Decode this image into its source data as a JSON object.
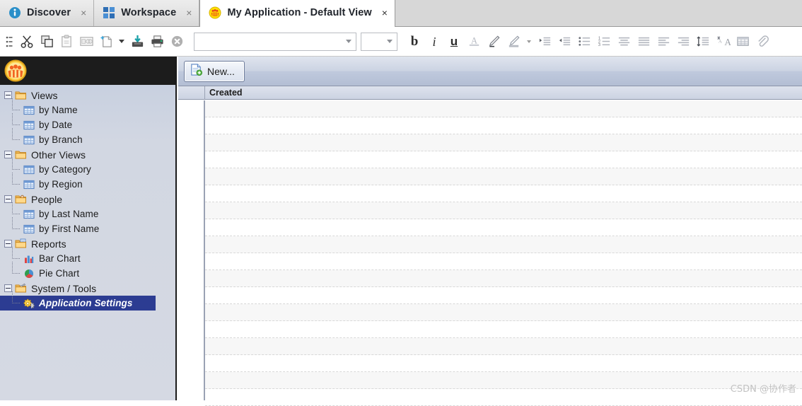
{
  "window": {
    "tabs": [
      {
        "label": "Discover",
        "icon": "info-icon",
        "close": "×",
        "active": false
      },
      {
        "label": "Workspace",
        "icon": "grid-squares-icon",
        "close": "×",
        "active": false
      },
      {
        "label": "My Application - Default View",
        "icon": "app-logo-icon",
        "close": "×",
        "active": true
      }
    ]
  },
  "toolbar": {
    "items": [
      {
        "name": "menu-handle-icon",
        "glyph": ""
      },
      {
        "name": "cut-icon",
        "glyph": ""
      },
      {
        "name": "copy-icon",
        "glyph": ""
      },
      {
        "name": "paste-icon",
        "glyph": ""
      },
      {
        "name": "paste-special-icon",
        "glyph": ""
      },
      {
        "name": "new-document-icon",
        "glyph": ""
      },
      {
        "name": "new-document-dropdown-icon",
        "glyph": ""
      },
      {
        "name": "save-icon",
        "glyph": ""
      },
      {
        "name": "print-icon",
        "glyph": ""
      },
      {
        "name": "delete-icon",
        "glyph": ""
      }
    ],
    "font_family_combo": {
      "value": "",
      "placeholder": ""
    },
    "font_size_combo": {
      "value": "",
      "placeholder": ""
    },
    "bold_label": "b",
    "italic_label": "i",
    "underline_label": "u",
    "format_items": [
      {
        "name": "font-color-icon"
      },
      {
        "name": "highlight-pen-icon"
      },
      {
        "name": "highlight-color-icon"
      },
      {
        "name": "highlight-color-dropdown-icon"
      },
      {
        "name": "increase-indent-icon"
      },
      {
        "name": "decrease-indent-icon"
      },
      {
        "name": "bullet-list-icon"
      },
      {
        "name": "numbered-list-icon"
      },
      {
        "name": "align-center-icon"
      },
      {
        "name": "align-justify-icon"
      },
      {
        "name": "align-left-icon"
      },
      {
        "name": "align-right-icon"
      },
      {
        "name": "line-spacing-icon"
      },
      {
        "name": "clear-formatting-icon"
      },
      {
        "name": "insert-table-icon"
      },
      {
        "name": "attachment-icon"
      }
    ]
  },
  "sidebar": {
    "brand": {
      "name": "app-logo-icon",
      "title": ""
    },
    "tree": [
      {
        "label": "Views",
        "type": "group",
        "icon": "folder-icon",
        "expanded": true,
        "selected": false
      },
      {
        "label": "by Name",
        "type": "child",
        "icon": "table-view-icon",
        "expanded": false,
        "selected": false
      },
      {
        "label": "by Date",
        "type": "child",
        "icon": "table-view-icon",
        "expanded": false,
        "selected": false
      },
      {
        "label": "by Branch",
        "type": "child",
        "icon": "table-view-icon",
        "expanded": false,
        "selected": false,
        "last": true
      },
      {
        "label": "Other Views",
        "type": "group",
        "icon": "folder-icon",
        "expanded": true,
        "selected": false
      },
      {
        "label": "by Category",
        "type": "child",
        "icon": "table-view-icon",
        "expanded": false,
        "selected": false
      },
      {
        "label": "by Region",
        "type": "child",
        "icon": "table-view-icon",
        "expanded": false,
        "selected": false,
        "last": true
      },
      {
        "label": "People",
        "type": "group",
        "icon": "people-folder-icon",
        "expanded": true,
        "selected": false
      },
      {
        "label": "by Last Name",
        "type": "child",
        "icon": "table-view-icon",
        "expanded": false,
        "selected": false
      },
      {
        "label": "by First Name",
        "type": "child",
        "icon": "table-view-icon",
        "expanded": false,
        "selected": false,
        "last": true
      },
      {
        "label": "Reports",
        "type": "group",
        "icon": "reports-folder-icon",
        "expanded": true,
        "selected": false
      },
      {
        "label": "Bar Chart",
        "type": "child",
        "icon": "bar-chart-icon",
        "expanded": false,
        "selected": false
      },
      {
        "label": "Pie Chart",
        "type": "child",
        "icon": "pie-chart-icon",
        "expanded": false,
        "selected": false,
        "last": true
      },
      {
        "label": "System / Tools",
        "type": "group",
        "icon": "tools-folder-icon",
        "expanded": true,
        "selected": false
      },
      {
        "label": "Application Settings",
        "type": "child",
        "icon": "settings-gears-icon",
        "expanded": false,
        "selected": true,
        "last": true
      }
    ]
  },
  "main": {
    "new_button_label": "New...",
    "grid": {
      "columns": [
        "",
        "Created"
      ],
      "rows": [],
      "row_count": 18
    }
  },
  "watermark": "CSDN @协作者",
  "colors": {
    "selection_blue": "#2c3c92",
    "sidebar_bg": "#d3d8e3",
    "main_toolbar_bg": "#bfc9dd",
    "accent_orange": "#f39c12",
    "tab_active_bg": "#ffffff"
  }
}
